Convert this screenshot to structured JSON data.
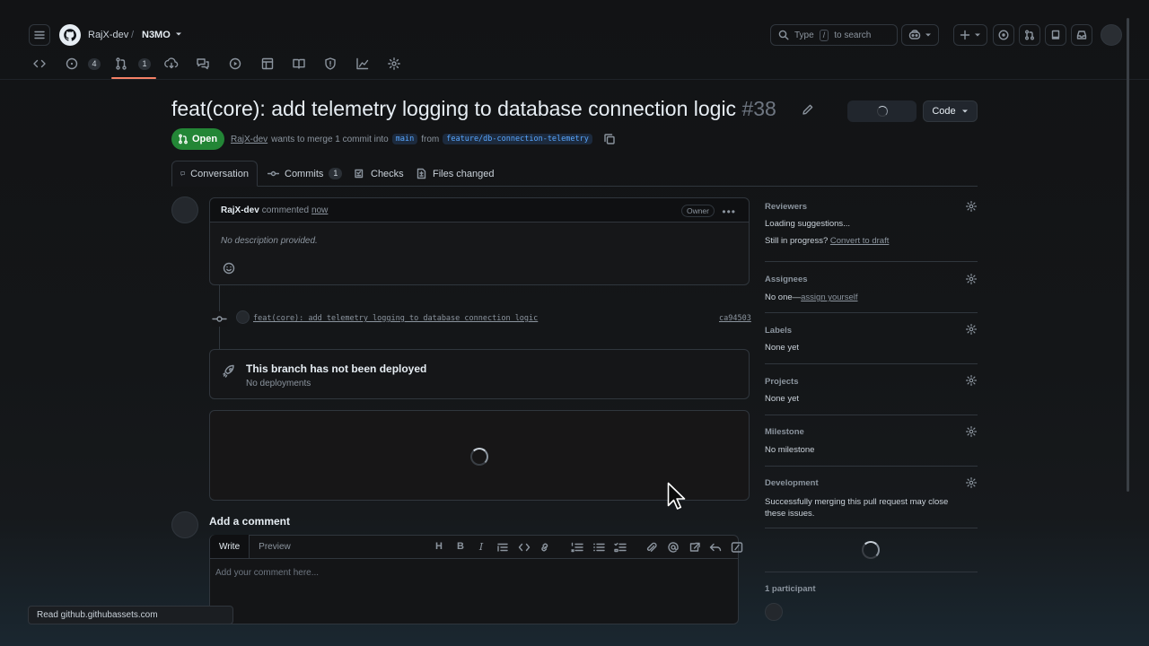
{
  "header": {
    "owner": "RajX-dev",
    "separator": "/",
    "repo": "N3MO",
    "search_prefix": "Type",
    "search_key": "/",
    "search_suffix": "to search"
  },
  "repo_nav": {
    "issues_count": "4",
    "pulls_count": "1"
  },
  "pr": {
    "title": "feat(core): add telemetry logging to database connection logic",
    "number": "#38",
    "code_button": "Code",
    "state": "Open",
    "author": "RajX-dev",
    "merge_text": "wants to merge 1 commit into",
    "base_branch": "main",
    "from_text": "from",
    "head_branch": "feature/db-connection-telemetry"
  },
  "tabs": [
    {
      "label": "Conversation"
    },
    {
      "label": "Commits",
      "count": "1"
    },
    {
      "label": "Checks"
    },
    {
      "label": "Files changed"
    }
  ],
  "comment": {
    "author": "RajX-dev",
    "action": "commented",
    "time": "now",
    "badge": "Owner",
    "body": "No description provided."
  },
  "commit": {
    "message": "feat(core): add telemetry logging to database connection logic",
    "sha": "ca94503"
  },
  "deployment": {
    "title": "This branch has not been deployed",
    "subtitle": "No deployments"
  },
  "add_comment": {
    "heading": "Add a comment",
    "write_tab": "Write",
    "preview_tab": "Preview",
    "placeholder": "Add your comment here..."
  },
  "sidebar": {
    "reviewers": {
      "title": "Reviewers",
      "line1": "Loading suggestions...",
      "line2_prefix": "Still in progress?",
      "line2_link": "Convert to draft"
    },
    "assignees": {
      "title": "Assignees",
      "prefix": "No one—",
      "link": "assign yourself"
    },
    "labels": {
      "title": "Labels",
      "value": "None yet"
    },
    "projects": {
      "title": "Projects",
      "value": "None yet"
    },
    "milestone": {
      "title": "Milestone",
      "value": "No milestone"
    },
    "development": {
      "title": "Development",
      "value": "Successfully merging this pull request may close these issues."
    },
    "participants": {
      "title": "1 participant"
    }
  },
  "status_bar": {
    "text": "Read github.githubassets.com"
  },
  "colors": {
    "accent_green": "#238636",
    "nav_underline": "#f78166",
    "link_blue": "#58a6ff"
  }
}
